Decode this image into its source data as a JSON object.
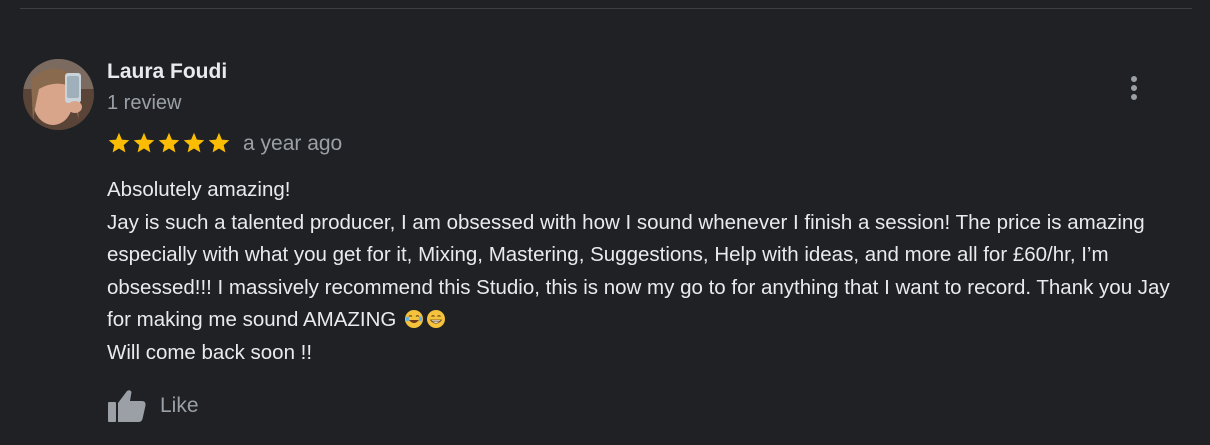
{
  "review": {
    "reviewer_name": "Laura Foudi",
    "review_count": "1 review",
    "rating": 5,
    "rating_max": 5,
    "time_ago": "a year ago",
    "body": {
      "line1": "Absolutely amazing!",
      "para": "Jay is such a talented producer, I am obsessed with how I sound whenever I finish a session! The price is amazing especially with what you get for it, Mixing, Mastering, Suggestions, Help with ideas, and more all for £60/hr, I’m obsessed!!! I massively recommend this Studio, this is now my go to for anything that I want to record. Thank you Jay for making me sound AMAZING",
      "closing": "Will come back soon !!",
      "emojis": [
        "laughing-tears-emoji",
        "grinning-emoji"
      ]
    },
    "like_label": "Like"
  },
  "colors": {
    "background": "#202124",
    "name_text": "#e8eaed",
    "secondary_text": "#9aa0a6",
    "star": "#fbbc04"
  },
  "icons": {
    "more": "more-vert-icon",
    "like": "thumb-up-icon",
    "star": "star-icon"
  }
}
